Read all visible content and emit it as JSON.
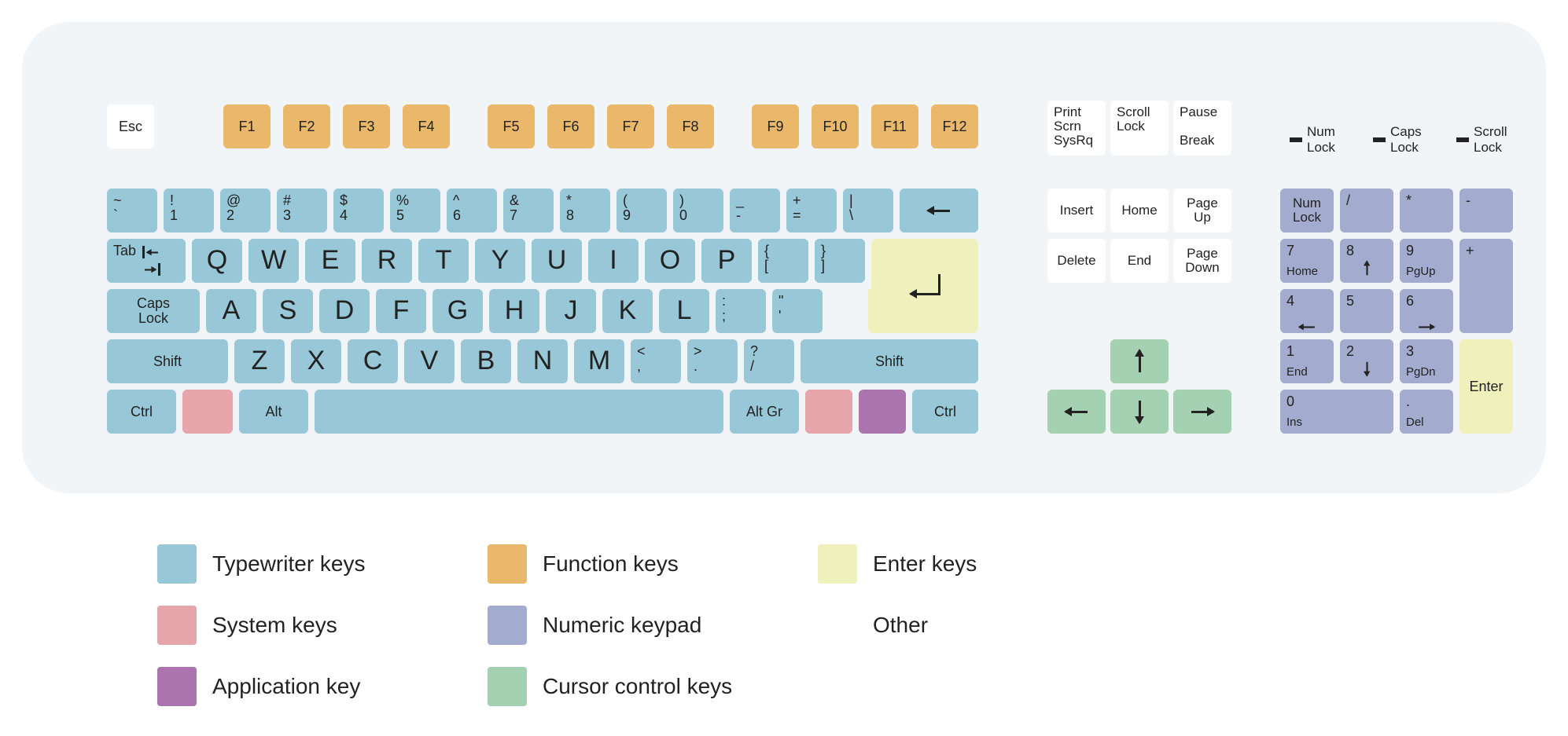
{
  "colors": {
    "typewriter": "#98c8d7",
    "function": "#e9b86a",
    "enter": "#eff1bc",
    "system": "#e6a5ab",
    "numeric": "#a3acce",
    "application": "#ab74ae",
    "cursor": "#a3d1b2",
    "other": "#ffffff"
  },
  "legend": [
    {
      "label": "Typewriter keys",
      "color": "typewriter"
    },
    {
      "label": "Function keys",
      "color": "function"
    },
    {
      "label": "Enter keys",
      "color": "enter"
    },
    {
      "label": "System keys",
      "color": "system"
    },
    {
      "label": "Numeric keypad",
      "color": "numeric"
    },
    {
      "label": "Other",
      "color": "other"
    },
    {
      "label": "Application key",
      "color": "application"
    },
    {
      "label": "Cursor control keys",
      "color": "cursor"
    }
  ],
  "indicators": [
    {
      "label": "Num\nLock"
    },
    {
      "label": "Caps\nLock"
    },
    {
      "label": "Scroll\nLock"
    }
  ],
  "keys": {
    "esc": "Esc",
    "f": [
      "F1",
      "F2",
      "F3",
      "F4",
      "F5",
      "F6",
      "F7",
      "F8",
      "F9",
      "F10",
      "F11",
      "F12"
    ],
    "sys3": [
      "Print\nScrn\nSysRq",
      "Scroll\nLock",
      "Pause\n\nBreak"
    ],
    "nav6": [
      "Insert",
      "Home",
      "Page\nUp",
      "Delete",
      "End",
      "Page\nDown"
    ],
    "row1": [
      {
        "top": "~",
        "bot": "`"
      },
      {
        "top": "!",
        "bot": "1"
      },
      {
        "top": "@",
        "bot": "2"
      },
      {
        "top": "#",
        "bot": "3"
      },
      {
        "top": "$",
        "bot": "4"
      },
      {
        "top": "%",
        "bot": "5"
      },
      {
        "top": "^",
        "bot": "6"
      },
      {
        "top": "&",
        "bot": "7"
      },
      {
        "top": "*",
        "bot": "8"
      },
      {
        "top": "(",
        "bot": "9"
      },
      {
        "top": ")",
        "bot": "0"
      },
      {
        "top": "_",
        "bot": "-"
      },
      {
        "top": "+",
        "bot": "="
      },
      {
        "top": "|",
        "bot": "\\"
      }
    ],
    "tab": "Tab",
    "row2": [
      "Q",
      "W",
      "E",
      "R",
      "T",
      "Y",
      "U",
      "I",
      "O",
      "P"
    ],
    "row2b": [
      {
        "top": "{",
        "bot": "["
      },
      {
        "top": "}",
        "bot": "]"
      }
    ],
    "caps": "Caps\nLock",
    "row3": [
      "A",
      "S",
      "D",
      "F",
      "G",
      "H",
      "J",
      "K",
      "L"
    ],
    "row3b": [
      {
        "top": ":",
        "bot": ";"
      },
      {
        "top": "\"",
        "bot": "'"
      }
    ],
    "shift": "Shift",
    "row4": [
      "Z",
      "X",
      "C",
      "V",
      "B",
      "N",
      "M"
    ],
    "row4b": [
      {
        "top": "<",
        "bot": ","
      },
      {
        "top": ">",
        "bot": "."
      },
      {
        "top": "?",
        "bot": "/"
      }
    ],
    "ctrl": "Ctrl",
    "alt": "Alt",
    "altgr": "Alt Gr",
    "numpad": {
      "numlock": "Num\nLock",
      "div": "/",
      "mul": "*",
      "sub": "-",
      "add": "+",
      "enter": "Enter",
      "7": {
        "n": "7",
        "s": "Home"
      },
      "8": {
        "n": "8",
        "s": "↑"
      },
      "9": {
        "n": "9",
        "s": "PgUp"
      },
      "4": {
        "n": "4",
        "s": "←"
      },
      "5": {
        "n": "5",
        "s": ""
      },
      "6": {
        "n": "6",
        "s": "→"
      },
      "1": {
        "n": "1",
        "s": "End"
      },
      "2": {
        "n": "2",
        "s": "↓"
      },
      "3": {
        "n": "3",
        "s": "PgDn"
      },
      "0": {
        "n": "0",
        "s": "Ins"
      },
      "dot": {
        "n": ".",
        "s": "Del"
      }
    }
  }
}
